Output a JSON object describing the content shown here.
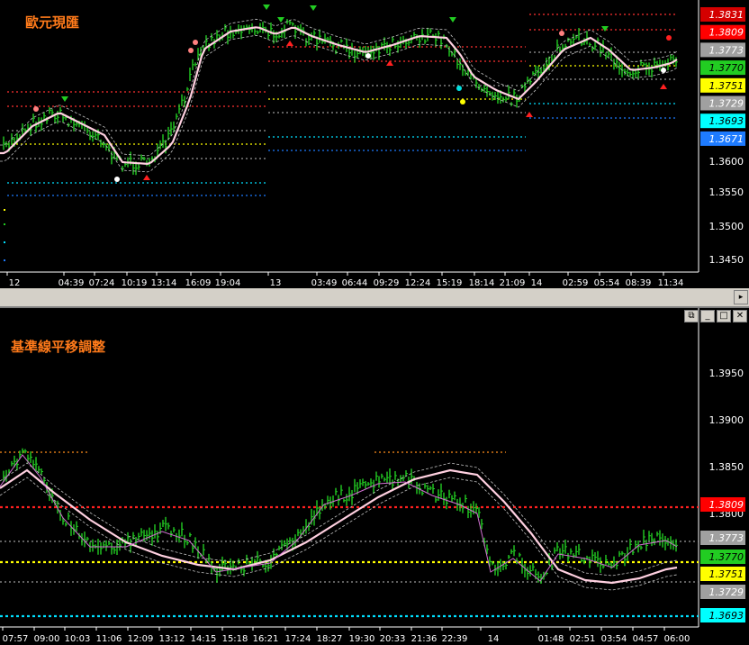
{
  "top_chart": {
    "title": "歐元現匯",
    "price_axis": [
      "1.3600",
      "1.3550",
      "1.3500",
      "1.3450"
    ],
    "price_badges": [
      {
        "value": "1.3831",
        "bg": "#d40000",
        "fg": "#ffffff"
      },
      {
        "value": "1.3809",
        "bg": "#ff0000",
        "fg": "#ffffff"
      },
      {
        "value": "1.3773",
        "bg": "#a0a0a0",
        "fg": "#ffffff"
      },
      {
        "value": "1.3770",
        "bg": "#22cc22",
        "fg": "#000000"
      },
      {
        "value": "1.3751",
        "bg": "#ffff00",
        "fg": "#000000"
      },
      {
        "value": "1.3729",
        "bg": "#a0a0a0",
        "fg": "#ffffff"
      },
      {
        "value": "1.3693",
        "bg": "#00ffff",
        "fg": "#000000"
      },
      {
        "value": "1.3671",
        "bg": "#1e7bff",
        "fg": "#ffffff"
      }
    ],
    "time_axis": [
      "12",
      "04:39",
      "07:24",
      "10:19",
      "13:14",
      "16:09",
      "19:04",
      "13",
      "03:49",
      "06:44",
      "09:29",
      "12:24",
      "15:19",
      "18:14",
      "21:09",
      "14",
      "02:59",
      "05:54",
      "08:39",
      "11:34"
    ]
  },
  "bottom_chart": {
    "title": "基準線平移調整",
    "price_axis": [
      "1.3950",
      "1.3900",
      "1.3850",
      "1.3800"
    ],
    "price_badges": [
      {
        "value": "1.3809",
        "bg": "#ff0000",
        "fg": "#ffffff"
      },
      {
        "value": "1.3773",
        "bg": "#a0a0a0",
        "fg": "#ffffff"
      },
      {
        "value": "1.3770",
        "bg": "#22cc22",
        "fg": "#000000"
      },
      {
        "value": "1.3751",
        "bg": "#ffff00",
        "fg": "#000000"
      },
      {
        "value": "1.3729",
        "bg": "#a0a0a0",
        "fg": "#ffffff"
      },
      {
        "value": "1.3693",
        "bg": "#00ffff",
        "fg": "#000000"
      }
    ],
    "time_axis": [
      "07:57",
      "09:00",
      "10:03",
      "11:06",
      "12:09",
      "13:12",
      "14:15",
      "15:18",
      "16:21",
      "17:24",
      "18:27",
      "19:30",
      "20:33",
      "21:36",
      "22:39",
      "14",
      "01:48",
      "02:51",
      "03:54",
      "04:57",
      "06:00"
    ]
  },
  "window_controls": {
    "restore_icon": "restore-icon",
    "minimize_icon": "minimize-icon",
    "maximize_icon": "maximize-icon",
    "close_icon": "close-icon",
    "restore_glyph": "⧉",
    "minimize_glyph": "_",
    "maximize_glyph": "□",
    "close_glyph": "✕"
  },
  "scrollbar": {
    "right_arrow_glyph": "▸"
  },
  "colors": {
    "bar_green": "#22cc22",
    "ma_line": "#ffd0e0",
    "envelope": "#c0c0c0"
  }
}
